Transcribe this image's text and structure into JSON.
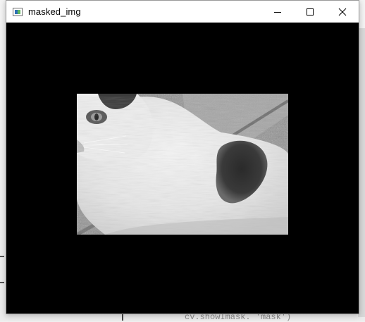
{
  "window": {
    "title": "masked_img",
    "icon": "opencv-window-icon",
    "controls": [
      "minimize-icon",
      "maximize-icon",
      "close-icon"
    ]
  },
  "image": {
    "content": "grayscale cat photo visible through rectangular mask",
    "mask_background": "#000000"
  },
  "background": {
    "code_snippet": "cv.showImask. 'mask')"
  }
}
